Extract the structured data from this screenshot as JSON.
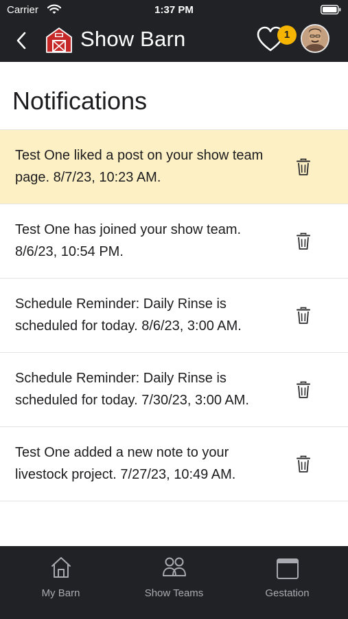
{
  "status_bar": {
    "carrier": "Carrier",
    "time": "1:37 PM"
  },
  "header": {
    "title": "Show Barn",
    "likes_badge": "1"
  },
  "page": {
    "title": "Notifications"
  },
  "notifications": [
    {
      "text": "Test One liked a post on your show team page. 8/7/23, 10:23 AM.",
      "unread": true
    },
    {
      "text": "Test One has joined your show team. 8/6/23, 10:54 PM.",
      "unread": false
    },
    {
      "text": "Schedule Reminder: Daily Rinse is scheduled for today. 8/6/23, 3:00 AM.",
      "unread": false
    },
    {
      "text": "Schedule Reminder: Daily Rinse is scheduled for today. 7/30/23, 3:00 AM.",
      "unread": false
    },
    {
      "text": "Test One added a new note to your livestock project. 7/27/23, 10:49 AM.",
      "unread": false
    }
  ],
  "tabs": [
    {
      "label": "My Barn",
      "icon": "home-icon"
    },
    {
      "label": "Show Teams",
      "icon": "people-icon"
    },
    {
      "label": "Gestation",
      "icon": "calendar-icon"
    }
  ],
  "colors": {
    "bar_background": "#202225",
    "highlight_background": "#fcf0c4",
    "badge": "#f4b400",
    "barn_red": "#c62828",
    "tab_label": "#a9abb0"
  }
}
